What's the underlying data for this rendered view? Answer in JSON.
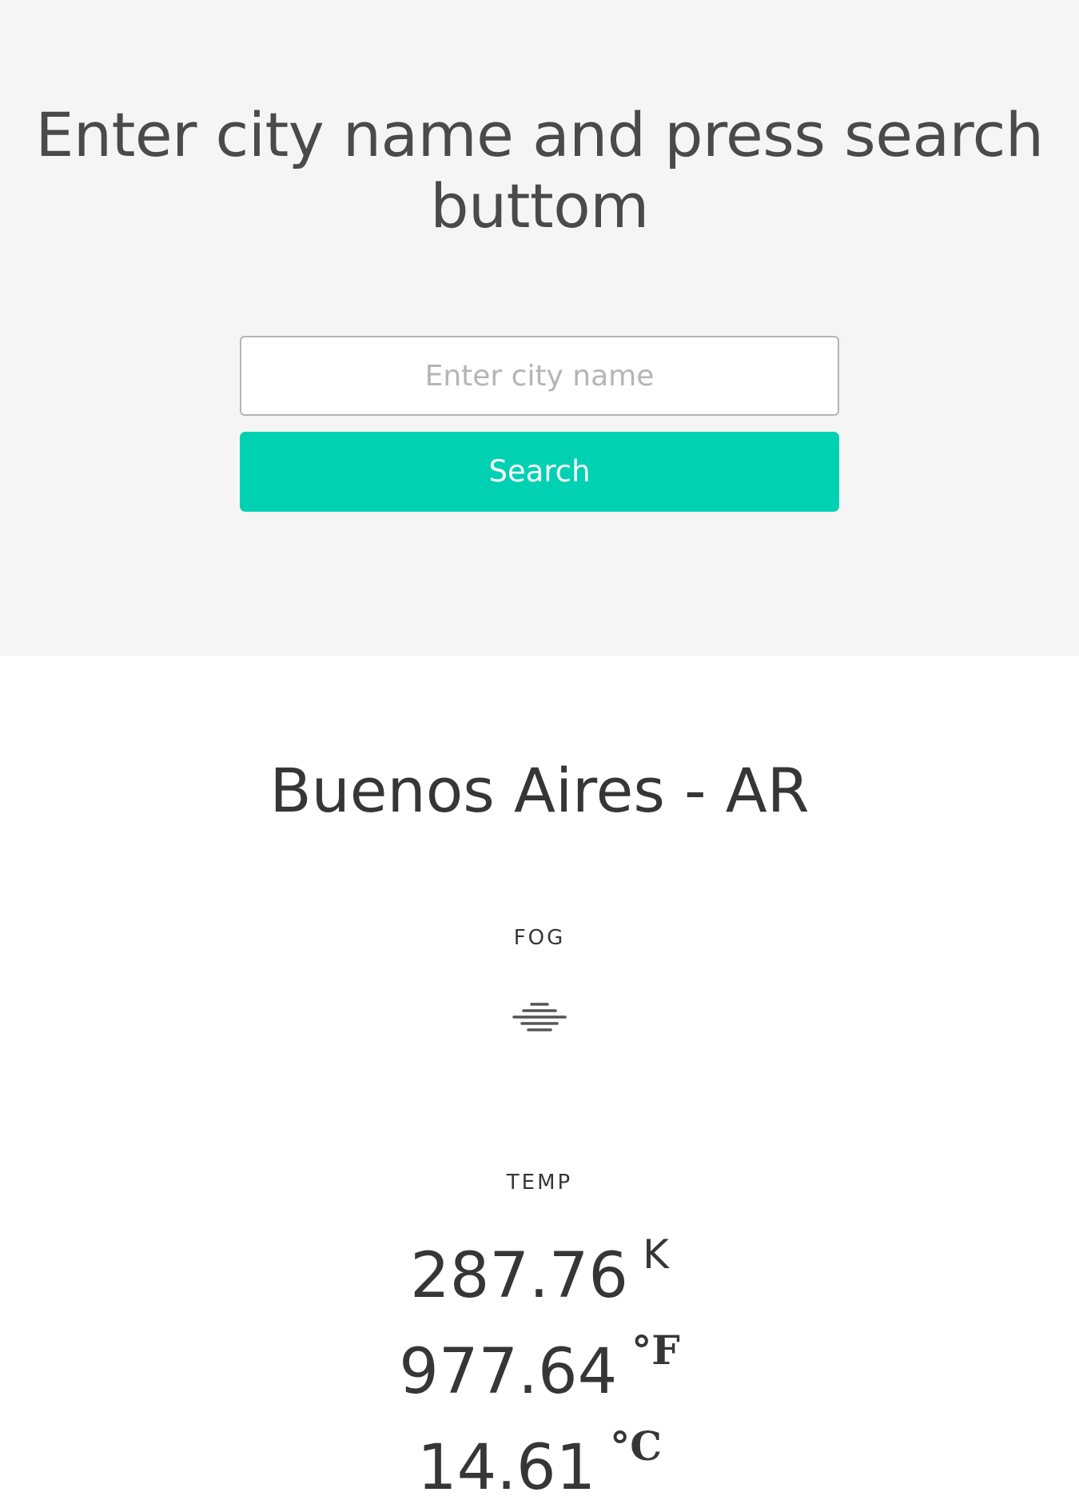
{
  "header": {
    "title": "Enter city name and press search buttom",
    "search_placeholder": "Enter city name",
    "search_value": "",
    "search_button_label": "Search"
  },
  "weather": {
    "city": "Buenos Aires - AR",
    "condition": "FOG",
    "condition_icon": "fog-icon",
    "temp_label": "TEMP",
    "temps": [
      {
        "value": "287.76",
        "unit": "K"
      },
      {
        "value": "977.64",
        "unit": "°F"
      },
      {
        "value": "14.61",
        "unit": "°C"
      }
    ]
  },
  "colors": {
    "hero_background": "#f5f5f5",
    "accent": "#00d1b2",
    "text": "#363636"
  }
}
